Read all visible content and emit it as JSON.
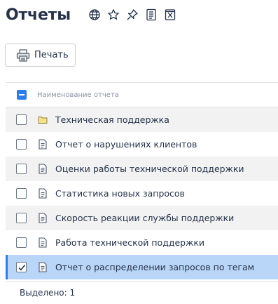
{
  "page": {
    "title": "Отчеты",
    "header_icons": [
      "globe-icon",
      "star-icon",
      "pin-icon",
      "document-list-icon",
      "excel-icon"
    ]
  },
  "toolbar": {
    "print_label": "Печать",
    "print_icon": "printer-icon"
  },
  "table": {
    "column_header": "Наименование отчета",
    "rows": [
      {
        "label": "Техническая поддержка",
        "icon": "folder-icon",
        "checked": false,
        "selected": false
      },
      {
        "label": "Отчет о нарушениях клиентов",
        "icon": "report-icon",
        "checked": false,
        "selected": false
      },
      {
        "label": "Оценки работы технической поддержки",
        "icon": "report-icon",
        "checked": false,
        "selected": false
      },
      {
        "label": "Статистика новых запросов",
        "icon": "report-icon",
        "checked": false,
        "selected": false
      },
      {
        "label": "Скорость реакции службы поддержки",
        "icon": "report-icon",
        "checked": false,
        "selected": false
      },
      {
        "label": "Работа технической поддержки",
        "icon": "report-icon",
        "checked": false,
        "selected": false
      },
      {
        "label": "Отчет о распределении запросов по тегам",
        "icon": "report-icon",
        "checked": true,
        "selected": true
      }
    ]
  },
  "footer": {
    "selected_text": "Выделено: 1"
  },
  "colors": {
    "accent": "#2b7de9",
    "selected_row": "#b9d6f8",
    "alt_row": "#f2f2f2",
    "text": "#26324a",
    "folder": "#f5e08a"
  }
}
